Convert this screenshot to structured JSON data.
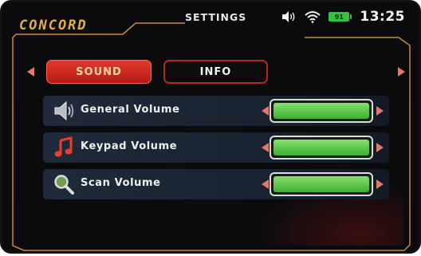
{
  "header": {
    "brand": "CONCORD",
    "title": "SETTINGS",
    "status": {
      "icons": [
        "speaker-volume-icon",
        "wifi-icon",
        "battery-icon"
      ],
      "battery_level": "91",
      "time": "13:25"
    }
  },
  "tabs": [
    {
      "label": "SOUND",
      "active": true
    },
    {
      "label": "INFO",
      "active": false
    }
  ],
  "settings": [
    {
      "label": "General Volume",
      "icon": "speaker-icon",
      "level": 1.0
    },
    {
      "label": "Keypad Volume",
      "icon": "music-note-icon",
      "level": 1.0
    },
    {
      "label": "Scan Volume",
      "icon": "magnifier-icon",
      "level": 1.0
    }
  ],
  "colors": {
    "accent": "#e3b23c",
    "tab_active": "#d3281f",
    "slider_fill": "#4cc23a",
    "row_bg": "#1b2433",
    "arrow": "#e07a6a"
  }
}
